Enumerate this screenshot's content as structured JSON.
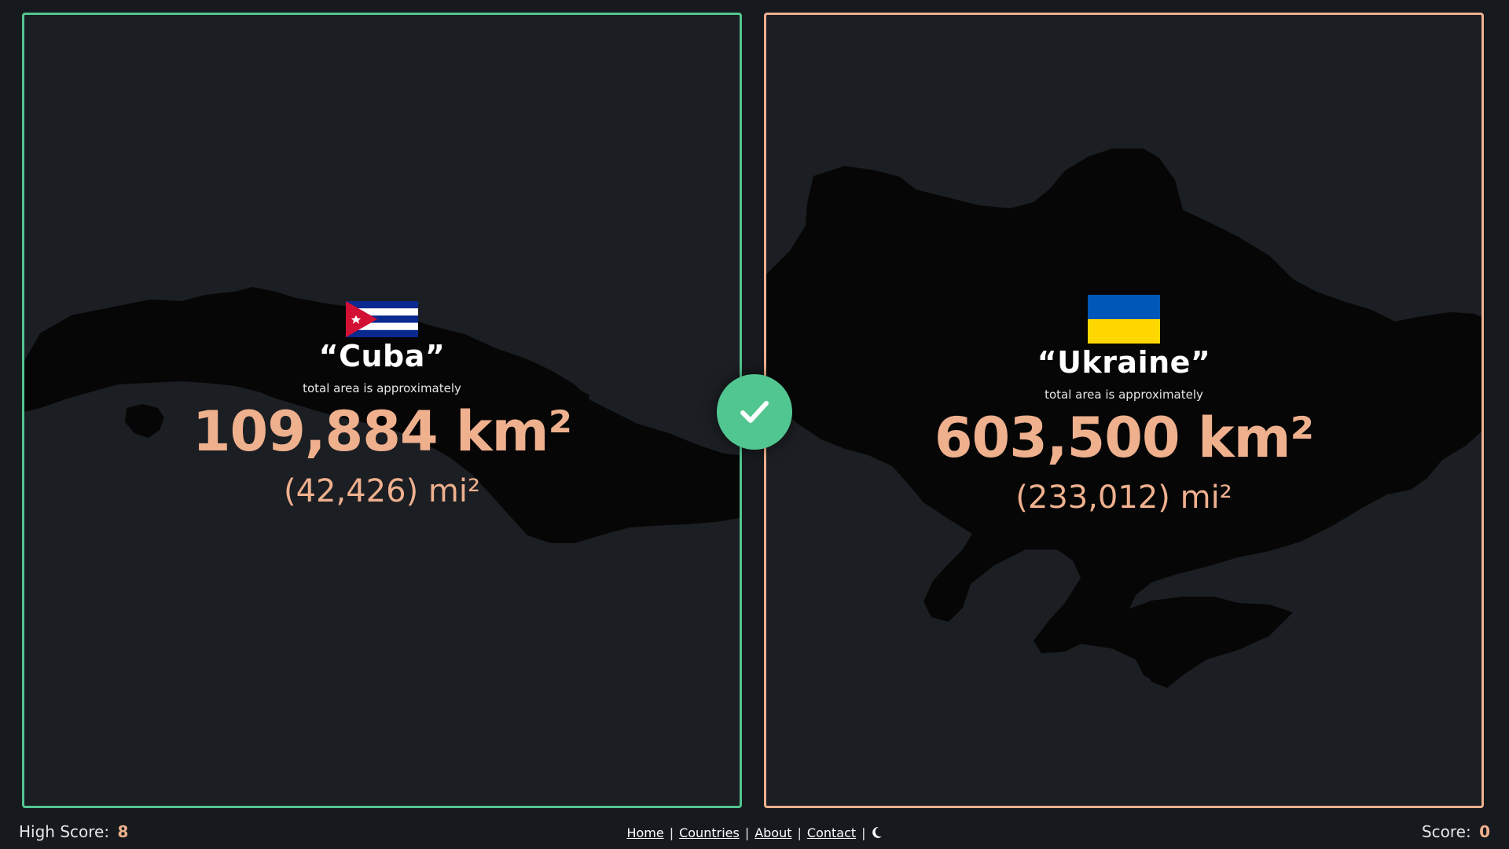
{
  "left_card": {
    "country_name": "“Cuba”",
    "flag": "flag-cuba",
    "caption": "total area is approximately",
    "area_km": "109,884 km²",
    "area_mi": "(42,426) mi²",
    "border_color": "#52c690"
  },
  "right_card": {
    "country_name": "“Ukraine”",
    "flag": "flag-ukraine",
    "caption": "total area is approximately",
    "area_km": "603,500 km²",
    "area_mi": "(233,012) mi²",
    "border_color": "#efb08e"
  },
  "result_icon": "check-icon",
  "footer": {
    "high_score_label": "High Score:",
    "high_score_value": "8",
    "score_label": "Score:",
    "score_value": "0",
    "nav": {
      "home": "Home",
      "countries": "Countries",
      "about": "About",
      "contact": "Contact",
      "separator": "|",
      "theme_icon": "moon-icon"
    }
  },
  "colors": {
    "accent": "#efb08e",
    "success": "#52c690",
    "background": "#16191d",
    "panel": "#1b1e22"
  }
}
